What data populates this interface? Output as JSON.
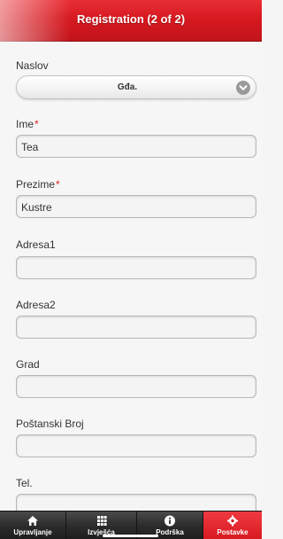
{
  "header": {
    "title": "Registration (2 of 2)"
  },
  "form": {
    "naslov": {
      "label": "Naslov",
      "selected": "Gđa."
    },
    "ime": {
      "label": "Ime",
      "required_mark": "*",
      "value": "Tea"
    },
    "prezime": {
      "label": "Prezime",
      "required_mark": "*",
      "value": "Kustre"
    },
    "adresa1": {
      "label": "Adresa1",
      "value": ""
    },
    "adresa2": {
      "label": "Adresa2",
      "value": ""
    },
    "grad": {
      "label": "Grad",
      "value": ""
    },
    "postanski_broj": {
      "label": "Poštanski Broj",
      "value": ""
    },
    "tel": {
      "label": "Tel.",
      "value": ""
    }
  },
  "tabbar": {
    "tabs": [
      {
        "label": "Upravljanje",
        "icon": "home-icon"
      },
      {
        "label": "Izvješća",
        "icon": "grid-icon"
      },
      {
        "label": "Podrška",
        "icon": "info-icon"
      },
      {
        "label": "Postavke",
        "icon": "gear-icon",
        "active": true
      }
    ]
  },
  "colors": {
    "accent": "#d71920",
    "tabbar": "#2d2d2d",
    "required": "#e02020"
  }
}
